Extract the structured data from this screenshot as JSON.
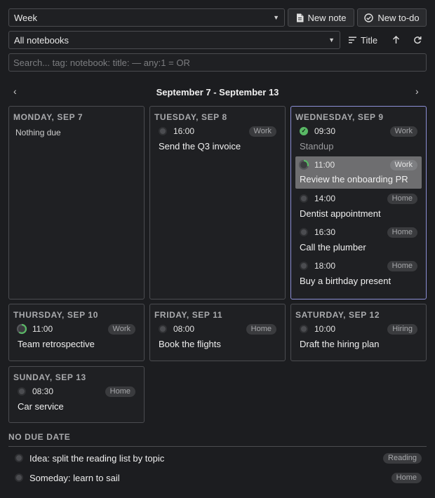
{
  "toolbar": {
    "view_select": "Week",
    "new_note_label": "New note",
    "new_todo_label": "New to-do",
    "notebook_select": "All notebooks",
    "sort_label": "Title",
    "search_placeholder": "Search... tag: notebook: title: — any:1 = OR"
  },
  "calendar": {
    "range_label": "September 7 - September 13",
    "days": [
      {
        "label": "MONDAY, SEP 7",
        "empty_text": "Nothing due"
      },
      {
        "label": "TUESDAY, SEP 8",
        "items": [
          {
            "time": "16:00",
            "tag": "Work",
            "title": "Send the Q3 invoice"
          }
        ]
      },
      {
        "label": "WEDNESDAY, SEP 9",
        "items": [
          {
            "time": "09:30",
            "tag": "Work",
            "title": "Standup",
            "done": true
          },
          {
            "time": "11:00",
            "tag": "Work",
            "title": "Review the onboarding PR",
            "progress": 0.3
          },
          {
            "time": "14:00",
            "tag": "Home",
            "title": "Dentist appointment"
          },
          {
            "time": "16:30",
            "tag": "Home",
            "title": "Call the plumber"
          },
          {
            "time": "18:00",
            "tag": "Home",
            "title": "Buy a birthday present"
          }
        ]
      },
      {
        "label": "THURSDAY, SEP 10",
        "items": [
          {
            "time": "11:00",
            "tag": "Work",
            "title": "Team retrospective",
            "progress": 0.6
          }
        ]
      },
      {
        "label": "FRIDAY, SEP 11",
        "items": [
          {
            "time": "08:00",
            "tag": "Home",
            "title": "Book the flights"
          }
        ]
      },
      {
        "label": "SATURDAY, SEP 12",
        "items": [
          {
            "time": "10:00",
            "tag": "Hiring",
            "title": "Draft the hiring plan"
          }
        ]
      },
      {
        "label": "SUNDAY, SEP 13",
        "items": [
          {
            "time": "08:30",
            "tag": "Home",
            "title": "Car service"
          }
        ]
      }
    ]
  },
  "no_due": {
    "heading": "NO DUE DATE",
    "items": [
      {
        "title": "Idea: split the reading list by topic",
        "tag": "Reading"
      },
      {
        "title": "Someday: learn to sail",
        "tag": "Home"
      }
    ]
  },
  "icons": {
    "caret": "caret-down-icon",
    "note": "note-icon",
    "todo": "check-circle-icon",
    "sort": "sort-lines-icon",
    "direction": "arrow-up-icon",
    "refresh": "refresh-icon",
    "prev": "chevron-left-icon",
    "next": "chevron-right-icon"
  },
  "colors": {
    "background": "#1c1d20",
    "today_border": "#8d8fd6",
    "done": "#59b865",
    "active_row": "#6e6e70"
  }
}
